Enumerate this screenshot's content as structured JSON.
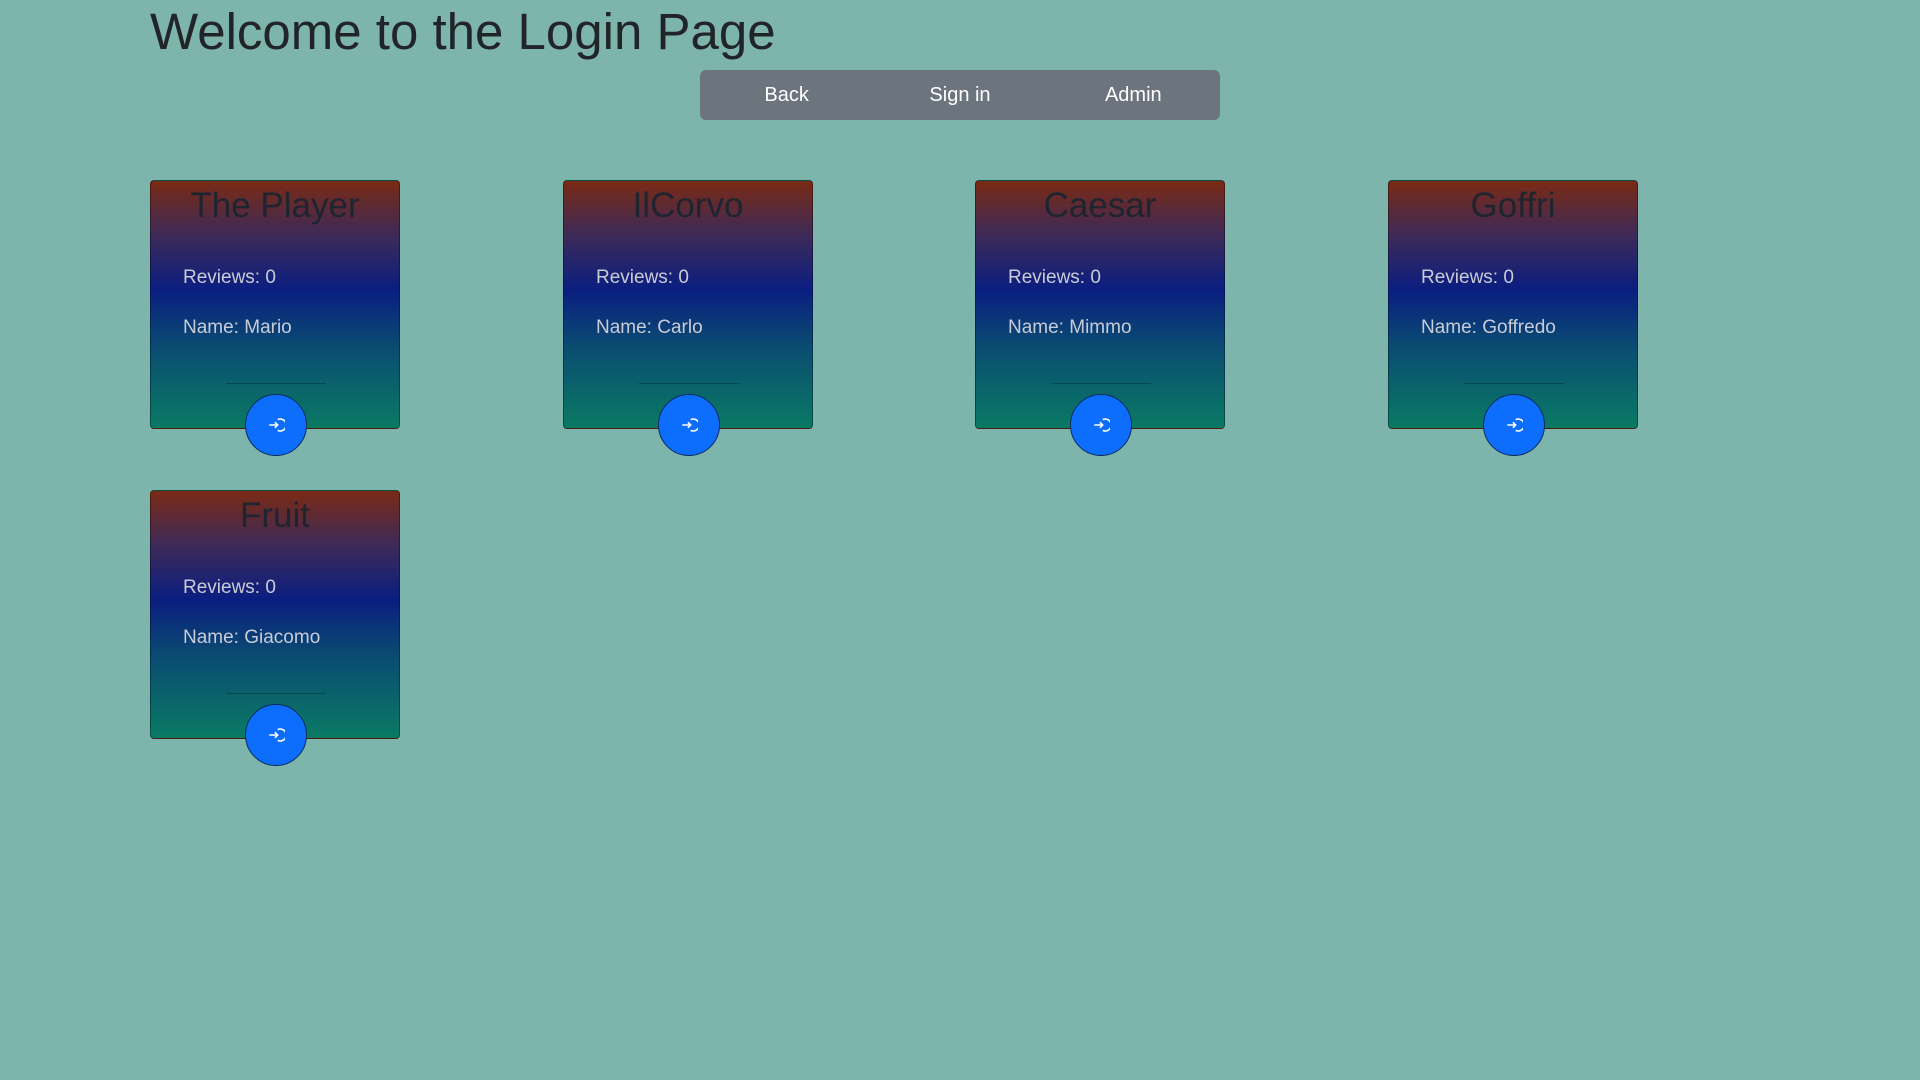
{
  "header": {
    "title": "Welcome to the Login Page"
  },
  "nav": {
    "back_label": "Back",
    "signin_label": "Sign in",
    "admin_label": "Admin"
  },
  "cards": [
    {
      "title": "The Player",
      "reviews": "Reviews: 0",
      "name": "Name: Mario",
      "icon": "login-icon"
    },
    {
      "title": "IlCorvo",
      "reviews": "Reviews: 0",
      "name": "Name: Carlo",
      "icon": "login-icon"
    },
    {
      "title": "Caesar",
      "reviews": "Reviews: 0",
      "name": "Name: Mimmo",
      "icon": "login-icon"
    },
    {
      "title": "Goffri",
      "reviews": "Reviews: 0",
      "name": "Name: Goffredo",
      "icon": "login-icon"
    },
    {
      "title": "Fruit",
      "reviews": "Reviews: 0",
      "name": "Name: Giacomo",
      "icon": "login-icon"
    }
  ],
  "colors": {
    "background": "#7db4ab",
    "nav_background": "#6c757d",
    "action_button": "#0d6efd"
  }
}
